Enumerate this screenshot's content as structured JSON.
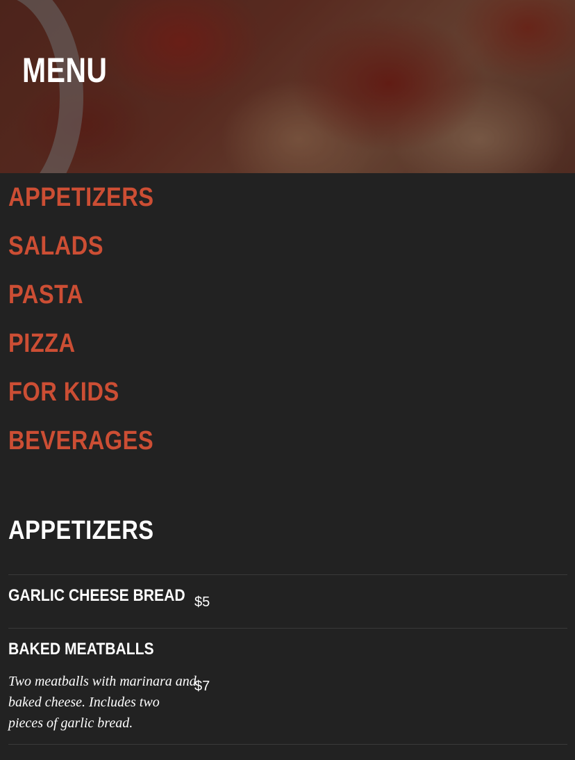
{
  "hero": {
    "title": "MENU"
  },
  "categories": [
    {
      "label": "APPETIZERS"
    },
    {
      "label": "SALADS"
    },
    {
      "label": "PASTA"
    },
    {
      "label": "PIZZA"
    },
    {
      "label": "FOR KIDS"
    },
    {
      "label": "BEVERAGES"
    }
  ],
  "section": {
    "title": "APPETIZERS",
    "items": [
      {
        "name": "GARLIC CHEESE BREAD",
        "price": "$5",
        "description": ""
      },
      {
        "name": "BAKED MEATBALLS",
        "price": "$7",
        "description": "Two meatballs with marinara and baked cheese. Includes two pieces of garlic bread."
      }
    ]
  },
  "colors": {
    "background": "#222222",
    "accent": "#cc4e34",
    "text": "#ffffff",
    "divider": "#3a3a3a"
  }
}
